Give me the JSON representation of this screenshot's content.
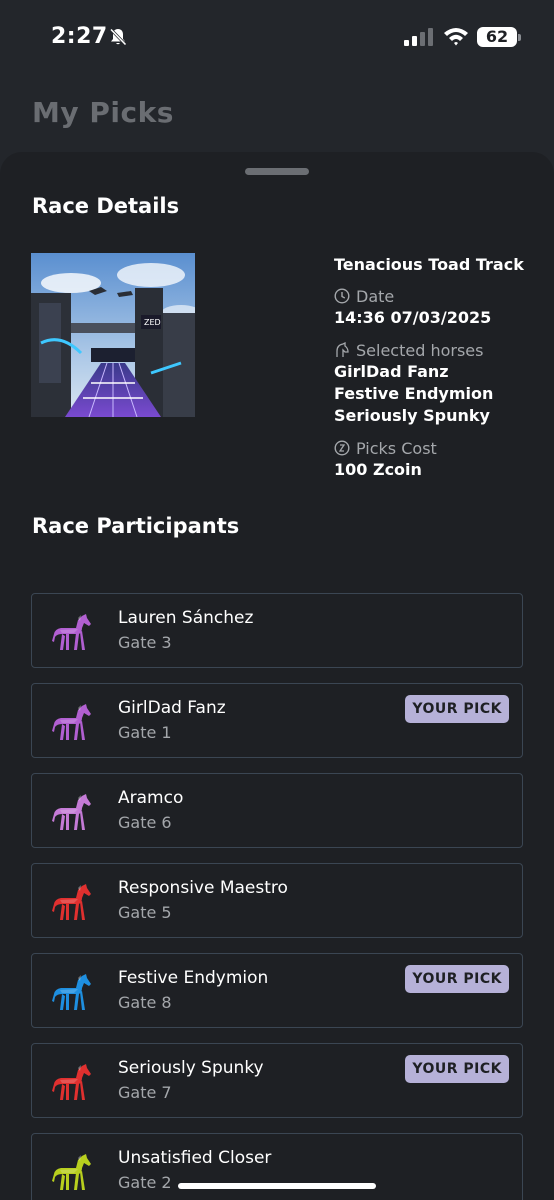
{
  "status_bar": {
    "time": "2:27",
    "battery": "62"
  },
  "page_title": "My Picks",
  "race_details": {
    "section_title": "Race Details",
    "track_name": "Tenacious Toad Track",
    "date_label": "Date",
    "date_value": "14:36 07/03/2025",
    "selected_horses_label": "Selected horses",
    "selected_horses": [
      "GirlDad Fanz",
      "Festive Endymion",
      "Seriously Spunky"
    ],
    "picks_cost_label": "Picks Cost",
    "picks_cost_value": "100 Zcoin"
  },
  "participants": {
    "section_title": "Race Participants",
    "badge_label": "YOUR PICK",
    "items": [
      {
        "name": "Lauren Sánchez",
        "gate": "Gate 3",
        "pick": false,
        "color": "#b15fd1"
      },
      {
        "name": "GirlDad Fanz",
        "gate": "Gate 1",
        "pick": true,
        "color": "#b15fd1"
      },
      {
        "name": "Aramco",
        "gate": "Gate 6",
        "pick": false,
        "color": "#c47ad6"
      },
      {
        "name": "Responsive Maestro",
        "gate": "Gate 5",
        "pick": false,
        "color": "#e0302f"
      },
      {
        "name": "Festive Endymion",
        "gate": "Gate 8",
        "pick": true,
        "color": "#1e8fe0"
      },
      {
        "name": "Seriously Spunky",
        "gate": "Gate 7",
        "pick": true,
        "color": "#e0302f"
      },
      {
        "name": "Unsatisfied Closer",
        "gate": "Gate 2",
        "pick": false,
        "color": "#b8cf1e"
      }
    ]
  }
}
